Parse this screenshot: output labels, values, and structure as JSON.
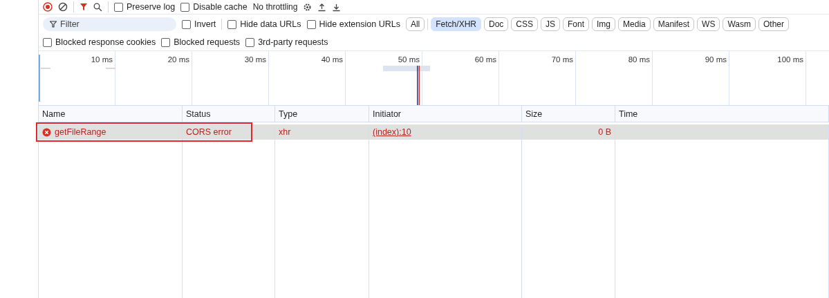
{
  "toolbar": {
    "checkboxes": [
      {
        "label": "Preserve log",
        "checked": false
      },
      {
        "label": "Disable cache",
        "checked": false
      }
    ],
    "throttling": "No throttling"
  },
  "filter": {
    "placeholder": "Filter",
    "options": [
      {
        "label": "Invert",
        "checked": false
      },
      {
        "label": "Hide data URLs",
        "checked": false
      },
      {
        "label": "Hide extension URLs",
        "checked": false
      }
    ],
    "types": [
      {
        "label": "All",
        "selected": false
      },
      {
        "label": "Fetch/XHR",
        "selected": true
      },
      {
        "label": "Doc",
        "selected": false
      },
      {
        "label": "CSS",
        "selected": false
      },
      {
        "label": "JS",
        "selected": false
      },
      {
        "label": "Font",
        "selected": false
      },
      {
        "label": "Img",
        "selected": false
      },
      {
        "label": "Media",
        "selected": false
      },
      {
        "label": "Manifest",
        "selected": false
      },
      {
        "label": "WS",
        "selected": false
      },
      {
        "label": "Wasm",
        "selected": false
      },
      {
        "label": "Other",
        "selected": false
      }
    ]
  },
  "more_filters": [
    {
      "label": "Blocked response cookies",
      "checked": false
    },
    {
      "label": "Blocked requests",
      "checked": false
    },
    {
      "label": "3rd-party requests",
      "checked": false
    }
  ],
  "overview": {
    "ticks": [
      "10 ms",
      "20 ms",
      "30 ms",
      "40 ms",
      "50 ms",
      "60 ms",
      "70 ms",
      "80 ms",
      "90 ms",
      "100 ms"
    ]
  },
  "table": {
    "columns": [
      "Name",
      "Status",
      "Type",
      "Initiator",
      "Size",
      "Time"
    ],
    "rows": [
      {
        "name": "getFileRange",
        "status": "CORS error",
        "type": "xhr",
        "initiator": "(index):10",
        "size": "0 B",
        "error": true,
        "selected": true,
        "highlighted": true
      }
    ]
  }
}
